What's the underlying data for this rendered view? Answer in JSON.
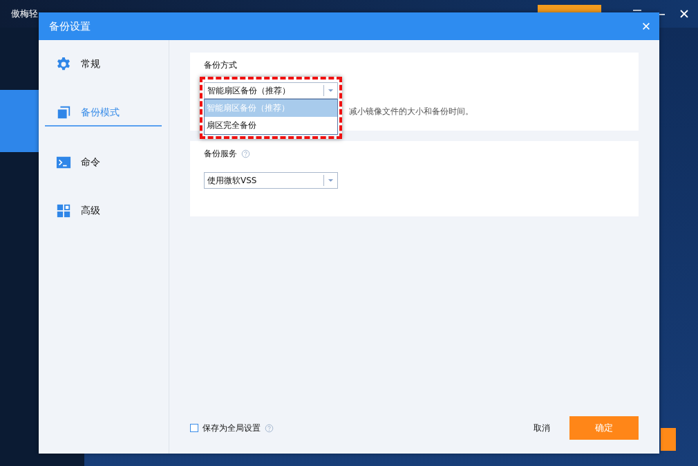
{
  "app": {
    "title": "傲梅轻"
  },
  "app_nav": [
    {
      "selected": false
    },
    {
      "selected": true
    },
    {
      "selected": false
    },
    {
      "selected": false
    },
    {
      "selected": false
    },
    {
      "selected": false
    }
  ],
  "dialog": {
    "title": "备份设置"
  },
  "nav": [
    {
      "label": "常规",
      "kind": "gear",
      "selected": false
    },
    {
      "label": "备份模式",
      "kind": "copy",
      "selected": true
    },
    {
      "label": "命令",
      "kind": "terminal",
      "selected": false
    },
    {
      "label": "高级",
      "kind": "grid",
      "selected": false
    }
  ],
  "backup_mode": {
    "label": "备份方式",
    "value": "智能扇区备份（推荐）",
    "expanded": true,
    "highlighted": true,
    "options": [
      {
        "label": "智能扇区备份（推荐）",
        "selected": true
      },
      {
        "label": "扇区完全备份",
        "selected": false
      }
    ],
    "description": "减小镜像文件的大小和备份时间。"
  },
  "backup_service": {
    "label": "备份服务",
    "value": "使用微软VSS"
  },
  "save_global": {
    "label": "保存为全局设置",
    "checked": false
  },
  "buttons": {
    "cancel": "取消",
    "ok": "确定"
  }
}
